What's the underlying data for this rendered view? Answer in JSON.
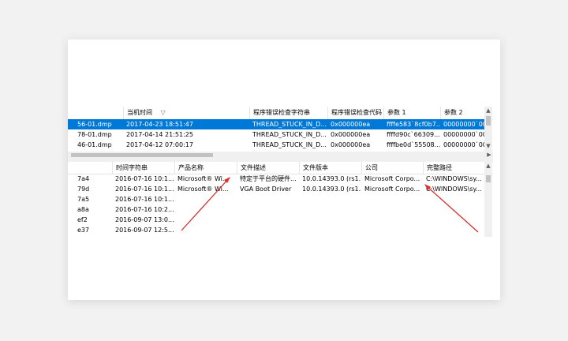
{
  "top_table": {
    "headers": [
      "当机时间",
      "程序错误检查字符串",
      "程序错误检查代码",
      "参数 1",
      "参数 2"
    ],
    "sort_indicator": "▽",
    "rows": [
      {
        "file": "56-01.dmp",
        "time": "2017-04-23 18:51:47",
        "check_string": "THREAD_STUCK_IN_D...",
        "code": "0x000000ea",
        "p1": "ffffe583`8cf0b7...",
        "p2": "00000000`00",
        "selected": true
      },
      {
        "file": "78-01.dmp",
        "time": "2017-04-14 21:51:25",
        "check_string": "THREAD_STUCK_IN_D...",
        "code": "0x000000ea",
        "p1": "ffffd90c`66309...",
        "p2": "00000000`00",
        "selected": false
      },
      {
        "file": "46-01.dmp",
        "time": "2017-04-12 07:00:17",
        "check_string": "THREAD_STUCK_IN_D...",
        "code": "0x000000ea",
        "p1": "ffffbe0d`55508...",
        "p2": "00000000`00",
        "selected": false
      }
    ]
  },
  "bottom_table": {
    "headers": [
      "时间字符串",
      "产品名称",
      "文件描述",
      "文件版本",
      "公司",
      "完整路径"
    ],
    "rows": [
      {
        "name": "7a4",
        "time": "2016-07-16 10:1...",
        "product": "Microsoft® Wi...",
        "desc": "特定于平台的硬件...",
        "version": "10.0.14393.0 (rs1...",
        "company": "Microsoft Corpo...",
        "path": "C:\\WINDOWS\\sy..."
      },
      {
        "name": "79d",
        "time": "2016-07-16 10:1...",
        "product": "Microsoft® Wi...",
        "desc": "VGA Boot Driver",
        "version": "10.0.14393.0 (rs1...",
        "company": "Microsoft Corpo...",
        "path": "C:\\WINDOWS\\sy..."
      },
      {
        "name": "7a5",
        "time": "2016-07-16 10:1...",
        "product": "",
        "desc": "",
        "version": "",
        "company": "",
        "path": ""
      },
      {
        "name": "a8a",
        "time": "2016-07-16 10:2...",
        "product": "",
        "desc": "",
        "version": "",
        "company": "",
        "path": ""
      },
      {
        "name": "ef2",
        "time": "2016-09-07 13:0...",
        "product": "",
        "desc": "",
        "version": "",
        "company": "",
        "path": ""
      },
      {
        "name": "e37",
        "time": "2016-09-07 12:5...",
        "product": "",
        "desc": "",
        "version": "",
        "company": "",
        "path": ""
      }
    ]
  },
  "colors": {
    "selection": "#0078d7",
    "annotation_arrow": "#d9302c"
  }
}
